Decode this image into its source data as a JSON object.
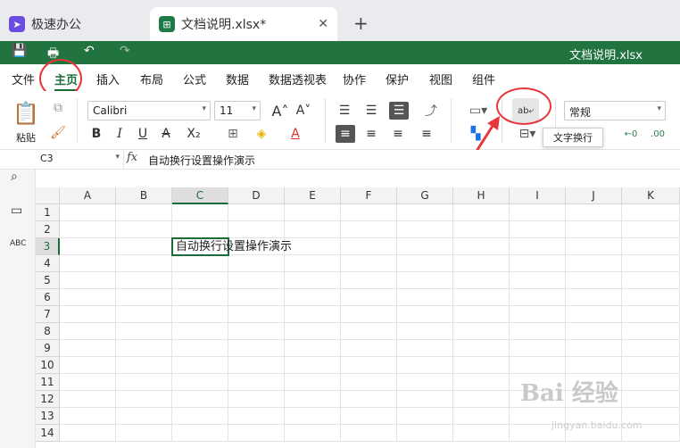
{
  "tabs": [
    {
      "label": "极速办公",
      "active": false
    },
    {
      "label": "文档说明.xlsx*",
      "active": true
    }
  ],
  "window_title": "文档说明.xlsx",
  "menu": [
    "文件",
    "主页",
    "插入",
    "布局",
    "公式",
    "数据",
    "数据透视表",
    "协作",
    "保护",
    "视图",
    "组件"
  ],
  "ribbon": {
    "paste_label": "粘贴",
    "font_name": "Calibri",
    "font_size": "11",
    "number_format": "常规",
    "tooltip": "文字换行"
  },
  "formula_bar": {
    "cell_ref": "C3",
    "fx": "fx",
    "content": "自动换行设置操作演示"
  },
  "sheet": {
    "columns": [
      "A",
      "B",
      "C",
      "D",
      "E",
      "F",
      "G",
      "H",
      "I",
      "J",
      "K"
    ],
    "rows": [
      "1",
      "2",
      "3",
      "4",
      "5",
      "6",
      "7",
      "8",
      "9",
      "10",
      "11",
      "12",
      "13",
      "14"
    ],
    "cell_c3": "自动换行设置操作演示"
  },
  "watermark": {
    "main": "Bai 经验",
    "sub": "jingyan.baidu.com"
  },
  "colors": {
    "accent": "#21733f",
    "annotation": "#e8363a"
  }
}
